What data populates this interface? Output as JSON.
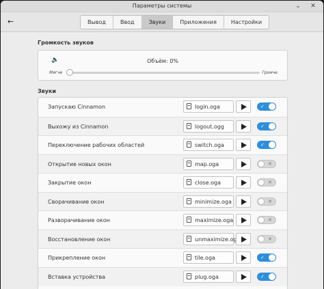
{
  "window": {
    "title": "Параметры системы"
  },
  "tabs": [
    {
      "label": "Вывод",
      "active": false
    },
    {
      "label": "Ввод",
      "active": false
    },
    {
      "label": "Звуки",
      "active": true
    },
    {
      "label": "Приложения",
      "active": false
    },
    {
      "label": "Настройки",
      "active": false
    }
  ],
  "volume": {
    "section_title": "Громкость звуков",
    "label": "Объём: 0%",
    "min_label": "Мягче",
    "max_label": "Громче",
    "value_percent": 0
  },
  "sounds": {
    "section_title": "Звуки",
    "rows": [
      {
        "label": "Запускаю Cinnamon",
        "file": "login.oga",
        "enabled": true
      },
      {
        "label": "Выхожу из Cinnamon",
        "file": "logout.ogg",
        "enabled": true
      },
      {
        "label": "Переключение рабочих областей",
        "file": "switch.oga",
        "enabled": true
      },
      {
        "label": "Открытие новых окон",
        "file": "map.oga",
        "enabled": false
      },
      {
        "label": "Закрытие окон",
        "file": "close.oga",
        "enabled": false
      },
      {
        "label": "Сворачивание окон",
        "file": "minimize.oga",
        "enabled": false
      },
      {
        "label": "Разворачивание окон",
        "file": "maximize.oga",
        "enabled": false
      },
      {
        "label": "Восстановление окон",
        "file": "unmaximize.oga",
        "enabled": false
      },
      {
        "label": "Прикрепление окон",
        "file": "tile.oga",
        "enabled": true
      },
      {
        "label": "Вставка устройства",
        "file": "plug.oga",
        "enabled": true
      }
    ]
  },
  "colors": {
    "accent": "#2f8ddc"
  }
}
